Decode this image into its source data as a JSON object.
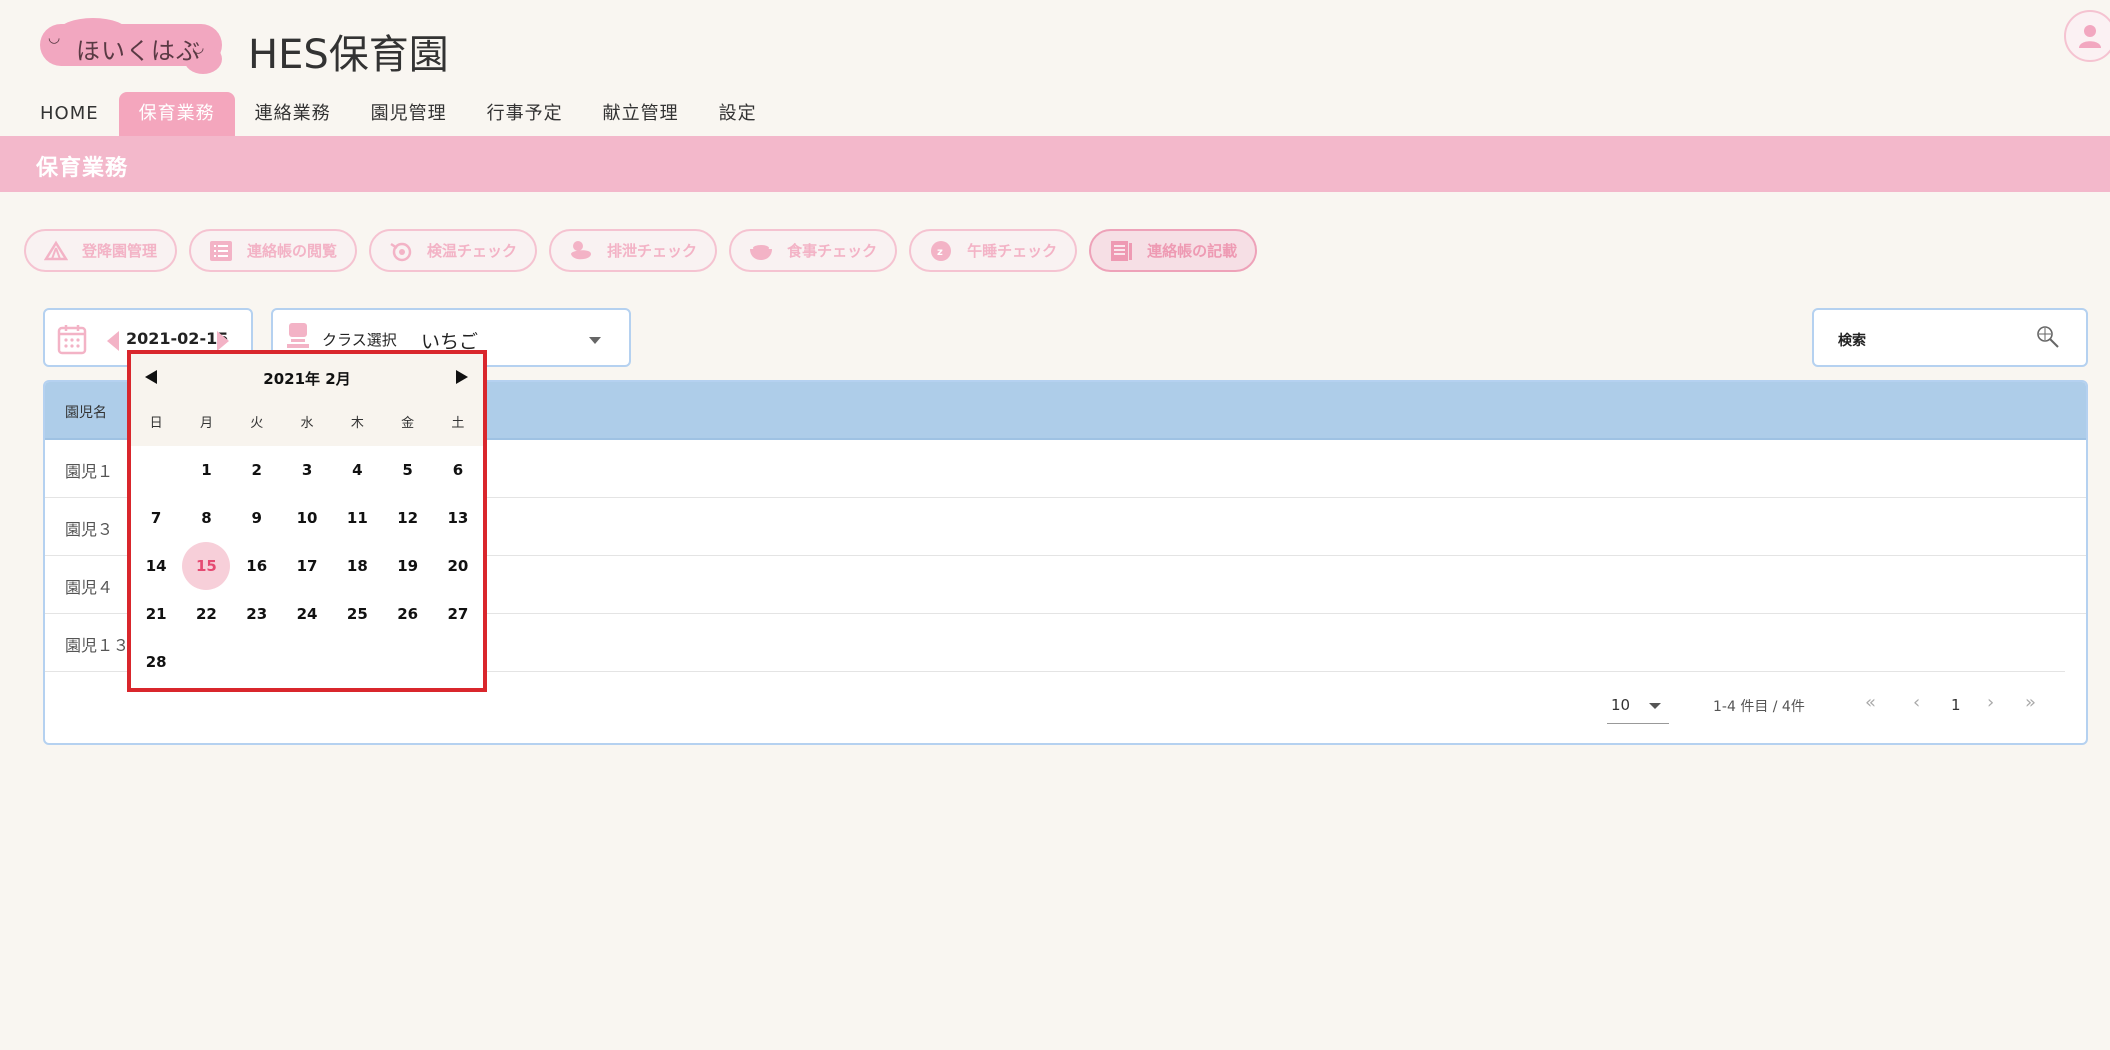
{
  "header": {
    "logo_text": "ほいくはぶ",
    "site_title": "HES保育園"
  },
  "nav": {
    "items": [
      {
        "label": "HOME"
      },
      {
        "label": "保育業務",
        "active": true
      },
      {
        "label": "連絡業務"
      },
      {
        "label": "園児管理"
      },
      {
        "label": "行事予定"
      },
      {
        "label": "献立管理"
      },
      {
        "label": "設定"
      }
    ]
  },
  "section": {
    "title": "保育業務"
  },
  "functions": [
    {
      "label": "登降園管理",
      "icon": "tent-icon"
    },
    {
      "label": "連絡帳の閲覧",
      "icon": "list-icon"
    },
    {
      "label": "検温チェック",
      "icon": "thermometer-icon"
    },
    {
      "label": "排泄チェック",
      "icon": "duck-icon"
    },
    {
      "label": "食事チェック",
      "icon": "bowl-icon"
    },
    {
      "label": "午睡チェック",
      "icon": "moon-icon"
    },
    {
      "label": "連絡帳の記載",
      "icon": "notebook-icon",
      "selected": true
    }
  ],
  "toolbar": {
    "date": "2021-02-15",
    "class_label": "クラス選択",
    "class_value": "いちご",
    "search_label": "検索"
  },
  "table": {
    "header": "園児名",
    "rows": [
      {
        "name": "園児１"
      },
      {
        "name": "園児３"
      },
      {
        "name": "園児４"
      },
      {
        "name": "園児１３"
      }
    ]
  },
  "pagination": {
    "per_page": "10",
    "range_text": "1-4 件目 / 4件",
    "current_page": "1"
  },
  "calendar": {
    "month_label": "2021年 2月",
    "weekdays": [
      "日",
      "月",
      "火",
      "水",
      "木",
      "金",
      "土"
    ],
    "first_weekday": 1,
    "days_in_month": 28,
    "selected_day": 15
  },
  "colors": {
    "accent_pink": "#f4a6bd",
    "header_blue": "#aecde9",
    "highlight_red": "#d9262c"
  }
}
